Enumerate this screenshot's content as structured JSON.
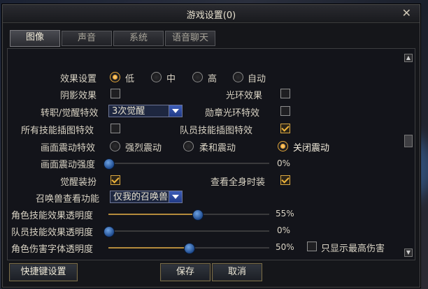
{
  "window": {
    "title": "游戏设置(0)",
    "close": "✕"
  },
  "tabs": [
    "图像",
    "声音",
    "系统",
    "语音聊天"
  ],
  "settings": {
    "effect_level": {
      "label": "效果设置",
      "options": [
        "低",
        "中",
        "高",
        "自动"
      ],
      "selected": "低"
    },
    "shadow": {
      "label": "阴影效果",
      "checked": false
    },
    "halo": {
      "label": "光环效果",
      "checked": false
    },
    "awaken_effect": {
      "label": "转职/觉醒特效",
      "value": "3次觉醒"
    },
    "medal_halo": {
      "label": "勋章光环特效",
      "checked": false
    },
    "skill_art": {
      "label": "所有技能插图特效",
      "checked": false
    },
    "team_skill_art": {
      "label": "队员技能插图特效",
      "checked": true
    },
    "shake": {
      "label": "画面震动特效",
      "options": [
        "强烈震动",
        "柔和震动",
        "关闭震动"
      ],
      "selected": "关闭震动"
    },
    "shake_strength": {
      "label": "画面震动强度",
      "percent": 0,
      "value_text": "0%"
    },
    "awaken_outfit": {
      "label": "觉醒装扮",
      "checked": true
    },
    "full_outfit": {
      "label": "查看全身时装",
      "checked": true
    },
    "pet_view": {
      "label": "召唤兽查看功能",
      "value": "仅我的召唤兽"
    },
    "char_skill_opacity": {
      "label": "角色技能效果透明度",
      "percent": 55,
      "value_text": "55%"
    },
    "team_skill_opacity": {
      "label": "队员技能效果透明度",
      "percent": 0,
      "value_text": "0%"
    },
    "damage_font_opacity": {
      "label": "角色伤害字体透明度",
      "percent": 50,
      "value_text": "50%"
    },
    "max_damage_only": {
      "label": "只显示最高伤害",
      "checked": false
    }
  },
  "buttons": {
    "shortcut": "快捷键设置",
    "save": "保存",
    "cancel": "取消"
  },
  "colors": {
    "accent": "#e0a43a",
    "knob": "#3e78c4",
    "panel": "#15161a"
  }
}
